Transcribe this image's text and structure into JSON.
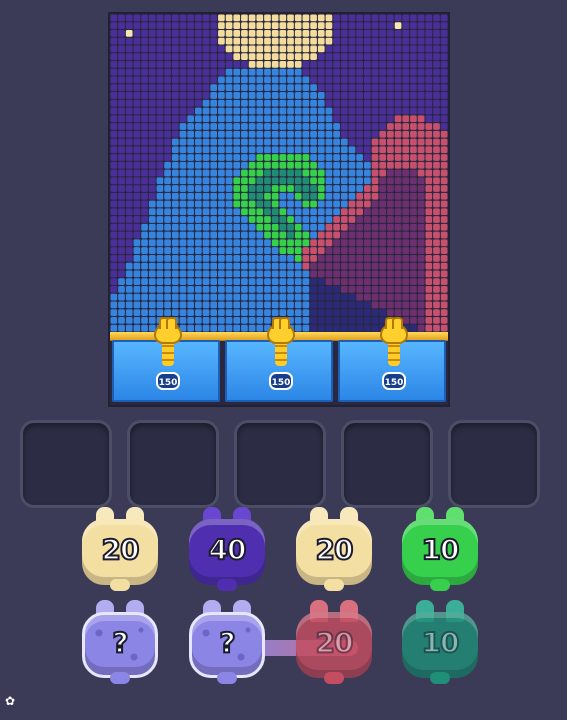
{
  "board": {
    "palette": {
      "N": "#4a2f9a",
      "S": "#3585e0",
      "C": "#f3dc9c",
      "G": "#34d14a",
      "T": "#1f8d75",
      "R": "#c8506c",
      "P": "#6d2f6f",
      "W": "#f7e7ae",
      "D": "#2b2a78"
    },
    "rows": [
      "NNNNNNNNNNNNNNCCCCCCCCCCCCCCCNNNNNNNNNNNNNNN",
      "NNNNNNNNNNNNNNCCCCCCCCCCCCCCCNNNNNNNNWNNNNNN",
      "NNWNNNNNNNNNNNCCCCCCCCCCCCCCCNNNNNNNNNNNNNNN",
      "NNNNNNNNNNNNNNCCCCCCCCCCCCCCCNNNNNNNNNNNNNNN",
      "NNNNNNNNNNNNNNNCCCCCCCCCCCCCNNNNNNNNNNNNNNNN",
      "NNNNNNNNNNNNNNNNCCCCCCCCCCCNNNNNNNNNNNNNNNNN",
      "NNNNNNNNNNNNNNNNNNCCCCCCCNNNNNNNNNNNNNNNNNNN",
      "NNNNNNNNNNNNNNNSSSSSSSSSSNNNNNNNNNNNNNNNNNNN",
      "NNNNNNNNNNNNNNSSSSSSSSSSSSNNNNNNNNNNNNNNNNNN",
      "NNNNNNNNNNNNNSSSSSSSSSSSSSSNNNNNNNNNNNNNNNNN",
      "NNNNNNNNNNNNNSSSSSSSSSSSSSSSNNNNNNNNNNNNNNNN",
      "NNNNNNNNNNNNSSSSSSSSSSSSSSSSNNNNNNNNNNNNNNNN",
      "NNNNNNNNNNNSSSSSSSSSSSSSSSSSSNNNNNNNNNNNNNNN",
      "NNNNNNNNNNSSSSSSSSSSSSSSSSSSSNNNNNNNNRRRRNNN",
      "NNNNNNNNNSSSSSSSSSSSSSSSSSSSSSNNNNNNRRRRRRRN",
      "NNNNNNNNNSSSSSSSSSSSSSSSSSSSSSNNNNNRRRRRRRRR",
      "NNNNNNNNSSSSSSSSSSSSSSSSSSSSSSSNNNRRRRRRRRRR",
      "NNNNNNNNSSSSSSSSSSSSSSSSSSSSSSSSNNRRRRRRRRRR",
      "NNNNNNNNSSSSSSSSSSSGGGGGGGSSSSSSSNRRRRRRRRRR",
      "NNNNNNNSSSSSSSSSSSGGGGGGGGGSSSSSSSRRRRRRRRRR",
      "NNNNNNNSSSSSSSSSSGGGTTTTTGGGSSSSSSRRPPPPRRRR",
      "NNNNNNSSSSSSSSSSGGGTTTTTTTGGSSSSSSRPPPPPPRRR",
      "NNNNNNSSSSSSSSSSGGTTTGGGTTTGSSSSSRRPPPPPPRRR",
      "NNNNNNSSSSSSSSSSGGTTGGSSGTTGSSSSRRRPPPPPPRRR",
      "NNNNNSSSSSSSSSSSGGGTTGSSSGGSSSSRRRPPPPPPPRRR",
      "NNNNNSSSSSSSSSSSSGGGTTGSSSSSSSRRRPPPPPPPPRRR",
      "NNNNNSSSSSSSSSSSSSGGGTTGSSSSSRRRPPPPPPPPPRRR",
      "NNNNSSSSSSSSSSSSSSSGGGTTGSSSRRRPPPPPPPPPPRRR",
      "NNNNSSSSSSSSSSSSSSSSGGGTGGSRRRPPPPPPPPPPPRRR",
      "NNNSSSSSSSSSSSSSSSSSSGGGGGRRRPPPPPPPPPPPPRRR",
      "NNNSSSSSSSSSSSSSSSSSSSGGGRRRPPPPPPPPPPPPPRRR",
      "NNNSSSSSSSSSSSSSSSSSSSSSGRRPPPPPPPPPPPPPPRRR",
      "NNSSSSSSSSSSSSSSSSSSSSSSSRPPPPPPPPPPPPPPPRRR",
      "NNSSSSSSSSSSSSSSSSSSSSSSSSPPPPPPPPPPPPPPPRRR",
      "NSSSSSSSSSSSSSSSSSSSSSSSSSDDPPPPPPPPPPPPPRRR",
      "NSSSSSSSSSSSSSSSSSSSSSSSSSDDDDPPPPPPPPPPPRRR",
      "SSSSSSSSSSSSSSSSSSSSSSSSSSDDDDDDPPPPPPPPPRRR",
      "SSSSSSSSSSSSSSSSSSSSSSSSSSDDDDDDDDPPPPPPPRRR",
      "SSSSSSSSSSSSSSSSSSSSSSSSSSDDDDDDDDDDPPPPPRRR",
      "SSSSSSSSSSSSSSSSSSSSSSSSSSDDDDDDDDDDDDPPPRRR",
      "SSSSSSSSSSSSSSSSSSSSSSSSSSDDDDDDDDDDDDDDPRRR"
    ]
  },
  "hoppers": [
    {
      "label": "150"
    },
    {
      "label": "150"
    },
    {
      "label": "150"
    }
  ],
  "slots_count": 5,
  "bunny_rows": {
    "front": [
      {
        "label": "20",
        "color": "#f4dfa2",
        "ear": "#f8e9bc"
      },
      {
        "label": "40",
        "color": "#4f2fb0",
        "ear": "#6a47d0"
      },
      {
        "label": "20",
        "color": "#f4dfa2",
        "ear": "#f8e9bc"
      },
      {
        "label": "10",
        "color": "#36d04d",
        "ear": "#5fe06e"
      }
    ],
    "back": [
      {
        "label": "?",
        "color": "#8b86e6",
        "ear": "#b1adf0",
        "kind": "mystery"
      },
      {
        "label": "?",
        "color": "#8b86e6",
        "ear": "#b1adf0",
        "kind": "mystery"
      },
      {
        "label": "20",
        "color": "#c44d61",
        "ear": "#d9707f",
        "kind": "ghost"
      },
      {
        "label": "10",
        "color": "#1f8f78",
        "ear": "#3aae96",
        "kind": "ghost"
      }
    ]
  },
  "icons": {
    "settings": "gear-icon"
  }
}
